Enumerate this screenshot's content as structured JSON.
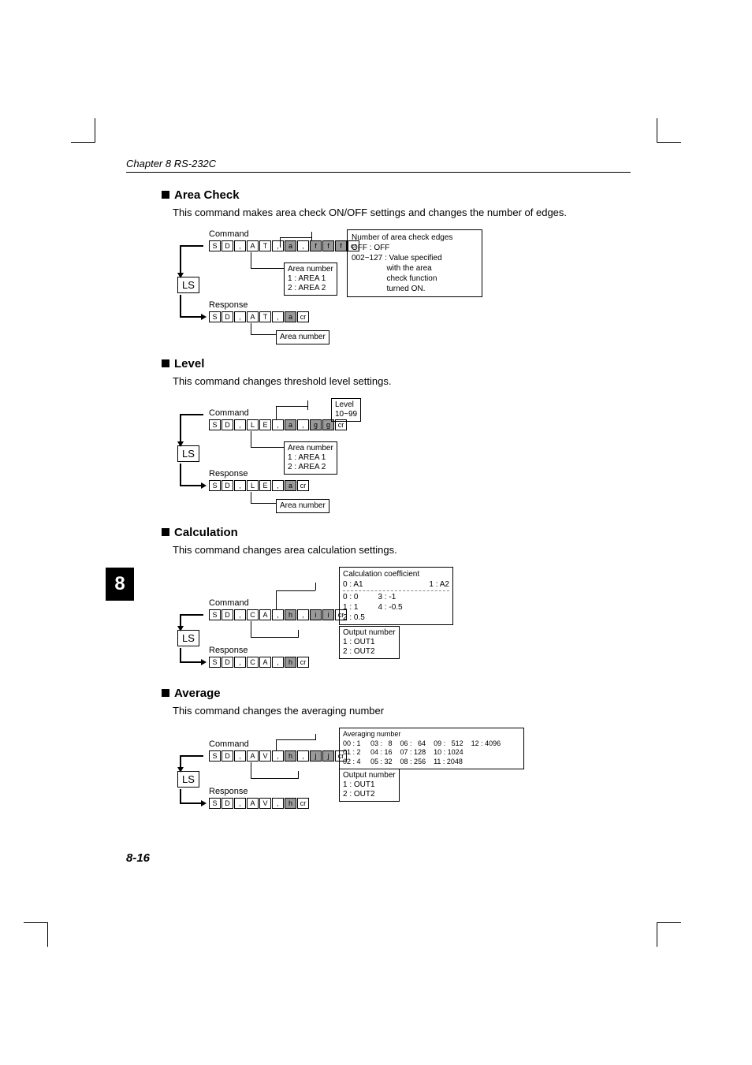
{
  "chapter": "Chapter 8  RS-232C",
  "chapter_tab": "8",
  "page_num": "8-16",
  "sections": {
    "area": {
      "title": "Area Check",
      "desc": "This command makes area check ON/OFF settings and changes the number of edges.",
      "cmd_label": "Command",
      "resp_label": "Response",
      "cmd_cells": [
        "S",
        "D",
        ",",
        "A",
        "T",
        ",",
        "a",
        ",",
        "f",
        "f",
        "f",
        "cr"
      ],
      "resp_cells": [
        "S",
        "D",
        ",",
        "A",
        "T",
        ",",
        "a",
        "cr"
      ],
      "area_num_label": "Area number",
      "area_num_lines": "1 : AREA 1\n2 : AREA 2",
      "note_title": "Number of area check edges",
      "note_body": "OFF : OFF\n002~127 : Value specified\n                with the area\n                check function\n                turned ON."
    },
    "level": {
      "title": "Level",
      "desc": "This command changes threshold level settings.",
      "cmd_label": "Command",
      "resp_label": "Response",
      "cmd_cells": [
        "S",
        "D",
        ",",
        "L",
        "E",
        ",",
        "a",
        ",",
        "g",
        "g",
        "cr"
      ],
      "resp_cells": [
        "S",
        "D",
        ",",
        "L",
        "E",
        ",",
        "a",
        "cr"
      ],
      "area_num_label": "Area number",
      "area_num_lines": "1 : AREA 1\n2 : AREA 2",
      "level_label": "Level",
      "level_range": "10~99"
    },
    "calc": {
      "title": "Calculation",
      "desc": "This command changes area calculation settings.",
      "cmd_label": "Command",
      "resp_label": "Response",
      "cmd_cells": [
        "S",
        "D",
        ",",
        "C",
        "A",
        ",",
        "h",
        ",",
        "i",
        "i",
        "cr"
      ],
      "resp_cells": [
        "S",
        "D",
        ",",
        "C",
        "A",
        ",",
        "h",
        "cr"
      ],
      "coeff_label": "Calculation coefficient",
      "coeff_left": "0 : A1",
      "coeff_right": "1 : A2",
      "coeff_body": "0 : 0         3 : -1\n1 : 1         4 : -0.5\n2 : 0.5",
      "out_label": "Output number",
      "out_lines": "1 : OUT1\n2 : OUT2"
    },
    "avg": {
      "title": "Average",
      "desc": "This command changes the averaging number",
      "cmd_label": "Command",
      "resp_label": "Response",
      "cmd_cells": [
        "S",
        "D",
        ",",
        "A",
        "V",
        ",",
        "h",
        ",",
        "j",
        "j",
        "cr"
      ],
      "resp_cells": [
        "S",
        "D",
        ",",
        "A",
        "V",
        ",",
        "h",
        "cr"
      ],
      "avg_label": "Averaging number",
      "avg_body": "00 : 1     03 :   8    06 :   64    09 :   512    12 : 4096\n01 : 2     04 : 16    07 : 128    10 : 1024\n02 : 4     05 : 32    08 : 256    11 : 2048",
      "out_label": "Output number",
      "out_lines": "1 : OUT1\n2 : OUT2"
    }
  },
  "ls": "LS"
}
